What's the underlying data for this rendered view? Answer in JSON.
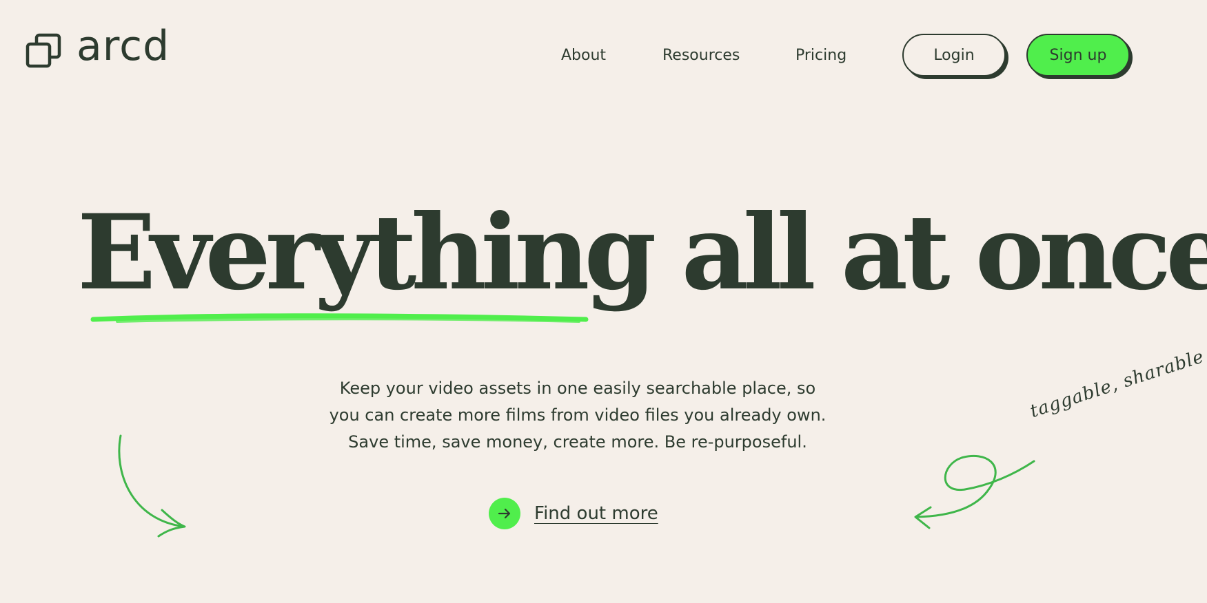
{
  "brand": {
    "name": "arcd",
    "logo_icon": "stacked-squares-icon"
  },
  "nav": {
    "links": [
      "About",
      "Resources",
      "Pricing"
    ],
    "login_label": "Login",
    "signup_label": "Sign up"
  },
  "hero": {
    "headline": "Everything all at once.",
    "subtext_lines": [
      "Keep your video assets in one easily searchable place, so",
      "you can create more films from video files you already own.",
      "Save time, save money, create more. Be re-purposeful."
    ],
    "cta_label": "Find out more",
    "cta_icon": "arrow-right-icon",
    "handwritten_note": "taggable, sharable"
  },
  "colors": {
    "background": "#f5efe9",
    "text": "#2d3b2f",
    "accent_green": "#50ee4c",
    "doodle_green": "#3fb64a"
  }
}
